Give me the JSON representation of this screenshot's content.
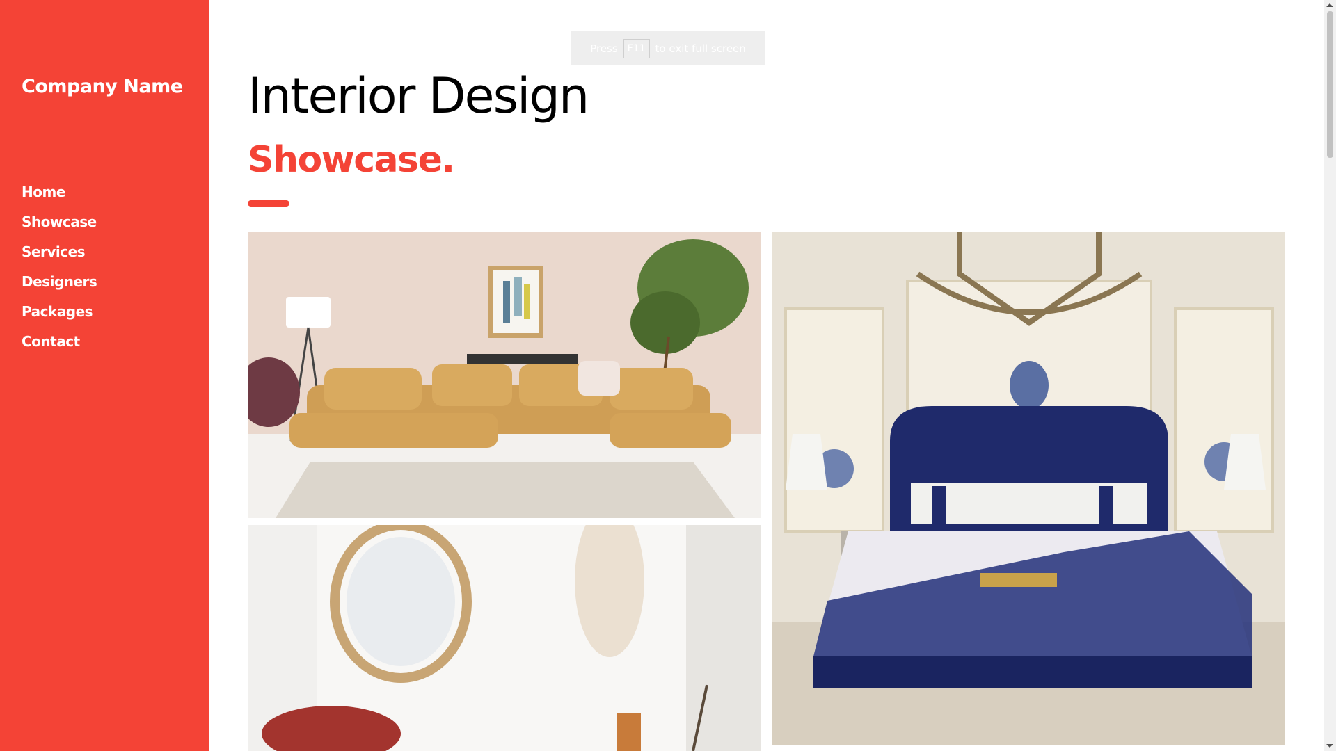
{
  "sidebar": {
    "brand": "Company Name",
    "nav": [
      {
        "label": "Home"
      },
      {
        "label": "Showcase"
      },
      {
        "label": "Services"
      },
      {
        "label": "Designers"
      },
      {
        "label": "Packages"
      },
      {
        "label": "Contact"
      }
    ]
  },
  "main": {
    "title": "Interior Design",
    "subtitle": "Showcase."
  },
  "fullscreen_hint": {
    "before": "Press",
    "key": "F11",
    "after": "to exit full screen"
  },
  "colors": {
    "accent": "#f44336",
    "text": "#000000",
    "sidebar_text": "#ffffff"
  },
  "icons": {
    "scroll_up": "chevron-up-icon",
    "scroll_down": "chevron-down-icon"
  }
}
